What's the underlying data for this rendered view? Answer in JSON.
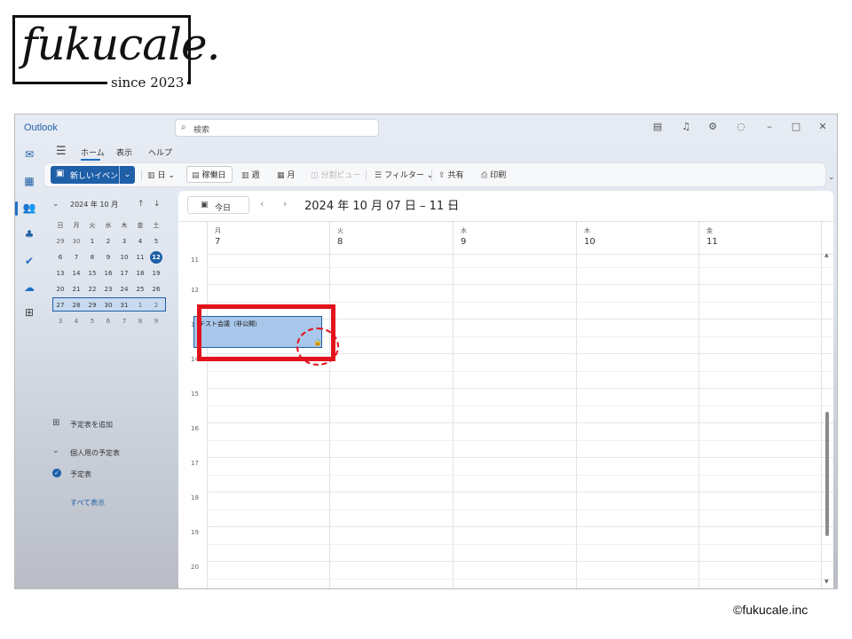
{
  "brand": {
    "logo_text": "fukucale.",
    "since": "since 2023",
    "copyright": "©fukucale.inc"
  },
  "app": {
    "name": "Outlook",
    "search_placeholder": "検索"
  },
  "titlebar_icons": [
    "notes-icon",
    "bell-icon",
    "gear-icon",
    "lightbulb-icon",
    "minimize-icon",
    "maximize-icon",
    "close-icon"
  ],
  "ribbon": {
    "tabs": [
      "ホーム",
      "表示",
      "ヘルプ"
    ],
    "new_event": "新しいイベント",
    "day": "日",
    "work_week": "稼働日",
    "week": "週",
    "month": "月",
    "split_view": "分割ビュー",
    "filter": "フィルター",
    "share": "共有",
    "print": "印刷"
  },
  "mini_calendar": {
    "title": "2024 年 10 月",
    "dow": [
      "日",
      "月",
      "火",
      "水",
      "木",
      "金",
      "土"
    ],
    "weeks": [
      [
        "29",
        "30",
        "1",
        "2",
        "3",
        "4",
        "5"
      ],
      [
        "6",
        "7",
        "8",
        "9",
        "10",
        "11",
        "12"
      ],
      [
        "13",
        "14",
        "15",
        "16",
        "17",
        "18",
        "19"
      ],
      [
        "20",
        "21",
        "22",
        "23",
        "24",
        "25",
        "26"
      ],
      [
        "27",
        "28",
        "29",
        "30",
        "31",
        "1",
        "2"
      ],
      [
        "3",
        "4",
        "5",
        "6",
        "7",
        "8",
        "9"
      ]
    ],
    "today": "12"
  },
  "sidebar": {
    "add_calendar": "予定表を追加",
    "personal_group": "個人用の予定表",
    "calendar_name": "予定表",
    "show_all": "すべて表示"
  },
  "calendar": {
    "today_button": "今日",
    "range_title": "2024 年 10 月 07 日 – 11 日",
    "days": [
      {
        "dow": "月",
        "num": "7"
      },
      {
        "dow": "火",
        "num": "8"
      },
      {
        "dow": "水",
        "num": "9"
      },
      {
        "dow": "木",
        "num": "10"
      },
      {
        "dow": "金",
        "num": "11"
      }
    ],
    "hours": [
      "11",
      "12",
      "13",
      "14",
      "15",
      "16",
      "17",
      "18",
      "19",
      "20"
    ],
    "event": {
      "title": "テスト会議（非公開）",
      "day": "月",
      "start": "13:00",
      "end": "14:00",
      "private": true
    }
  },
  "colors": {
    "accent": "#1e5fa8",
    "event_fill": "#a9c7ea",
    "highlight": "#e2111b"
  }
}
